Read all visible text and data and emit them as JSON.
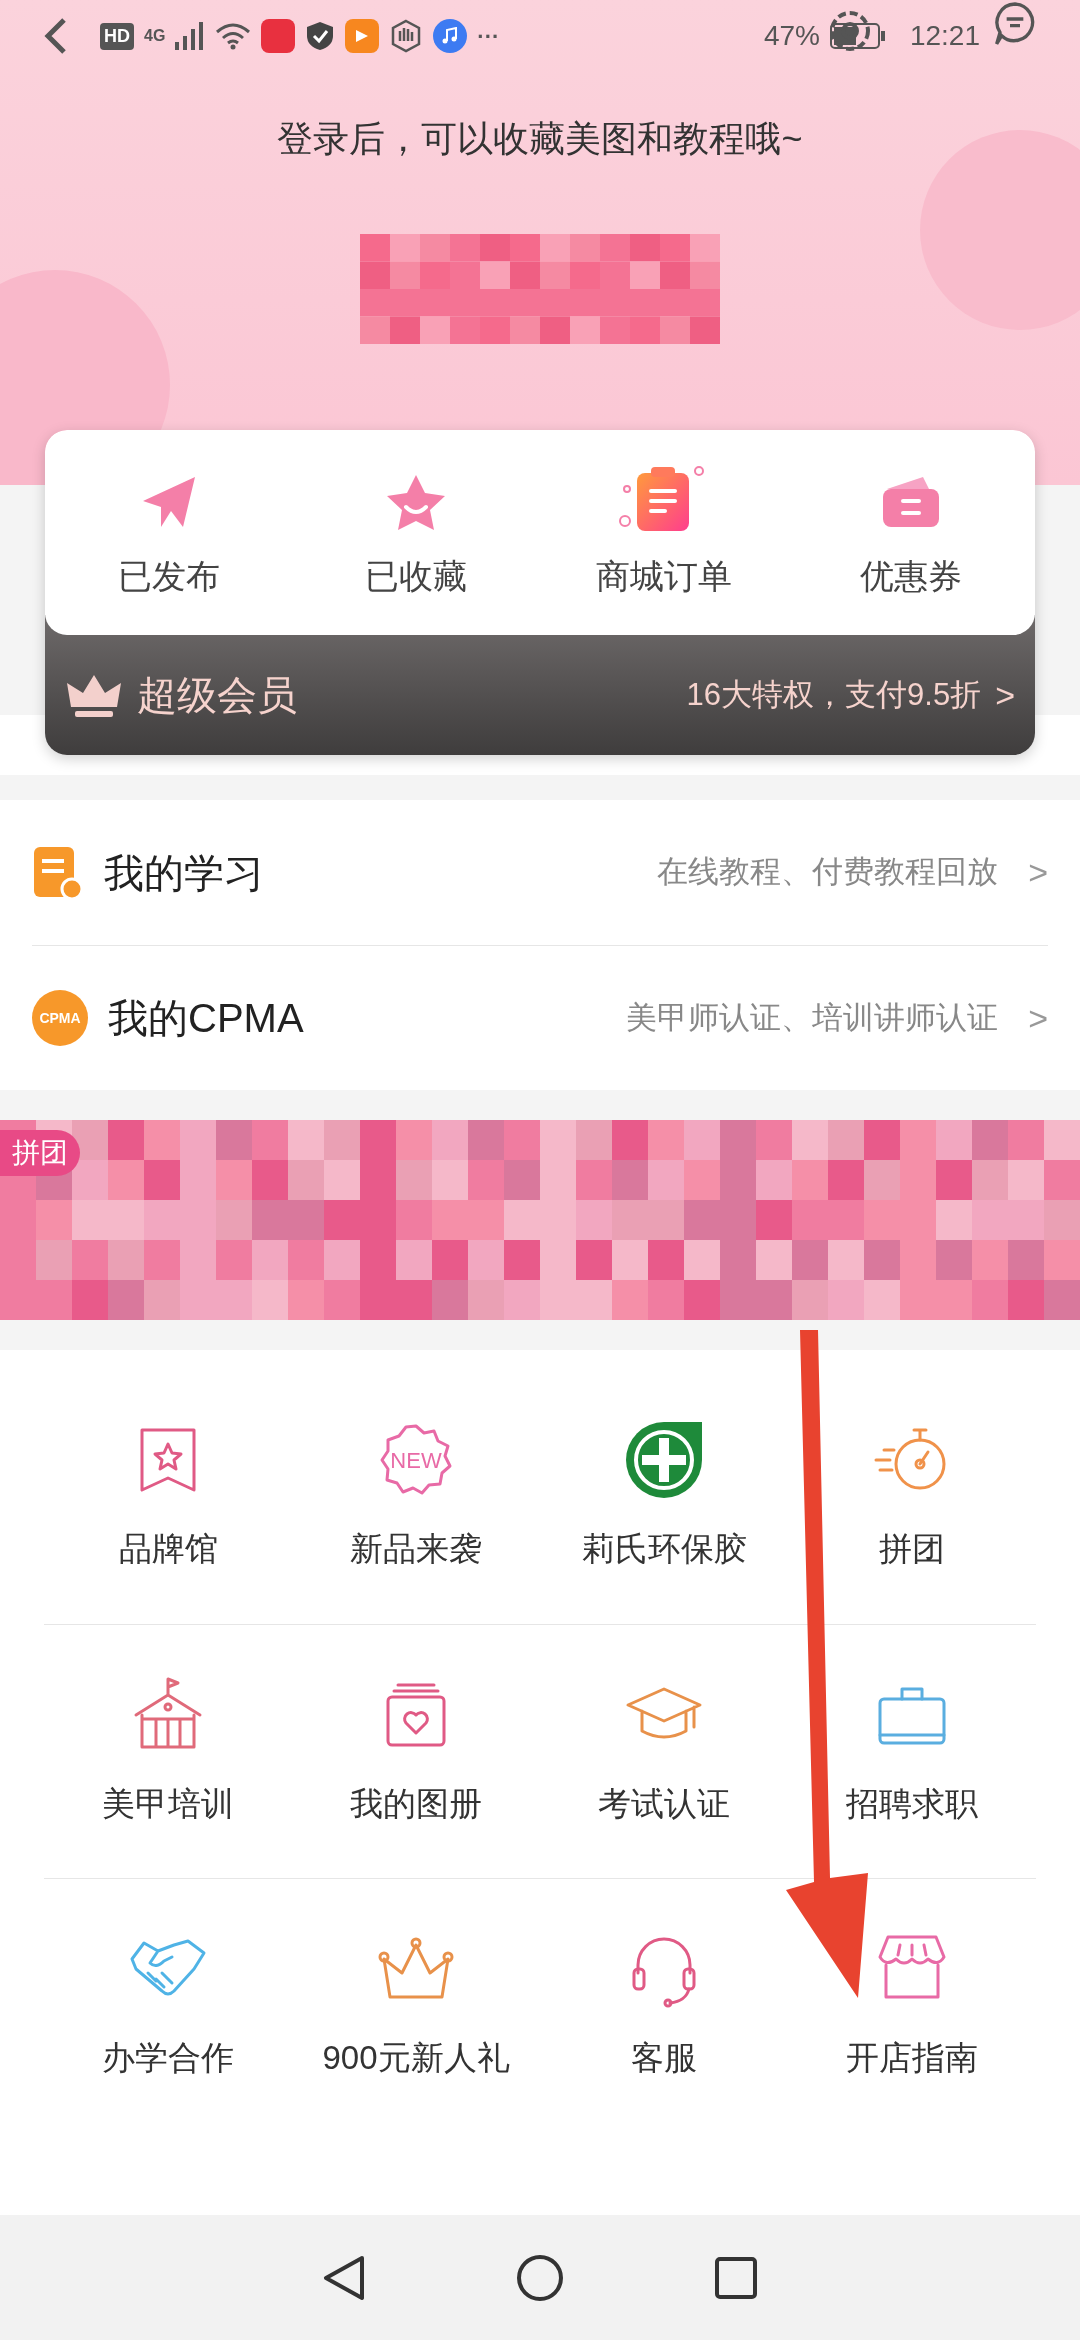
{
  "status_bar": {
    "icons": [
      "HD",
      "4G"
    ],
    "more": "···",
    "battery": "47%",
    "time": "12:21"
  },
  "header": {
    "prompt": "登录后，可以收藏美图和教程哦~"
  },
  "quick_actions": [
    {
      "label": "已发布",
      "kind": "plane"
    },
    {
      "label": "已收藏",
      "kind": "star"
    },
    {
      "label": "商城订单",
      "kind": "clipboard"
    },
    {
      "label": "优惠券",
      "kind": "coupon"
    }
  ],
  "vip_bar": {
    "title": "超级会员",
    "subtitle": "16大特权，支付9.5折",
    "arrow": ">"
  },
  "list": [
    {
      "title": "我的学习",
      "subtitle": "在线教程、付费教程回放",
      "kind": "study",
      "arrow": ">"
    },
    {
      "title": "我的CPMA",
      "subtitle": "美甲师认证、培训讲师认证",
      "kind": "badge",
      "badge": "CPMA",
      "arrow": ">"
    }
  ],
  "banner": {
    "tag": "拼团",
    "kind": "picture"
  },
  "grid": [
    {
      "label": "品牌馆",
      "kind": "bookmark"
    },
    {
      "label": "新品来袭",
      "kind": "new",
      "badge": "NEW"
    },
    {
      "label": "莉氏环保胶",
      "kind": "plus"
    },
    {
      "label": "拼团",
      "kind": "timer"
    },
    {
      "label": "美甲培训",
      "kind": "school"
    },
    {
      "label": "我的图册",
      "kind": "album"
    },
    {
      "label": "考试认证",
      "kind": "cap"
    },
    {
      "label": "招聘求职",
      "kind": "briefcase"
    },
    {
      "label": "办学合作",
      "kind": "handshake"
    },
    {
      "label": "900元新人礼",
      "kind": "crown"
    },
    {
      "label": "客服",
      "kind": "headset"
    },
    {
      "label": "开店指南",
      "kind": "shop"
    }
  ]
}
